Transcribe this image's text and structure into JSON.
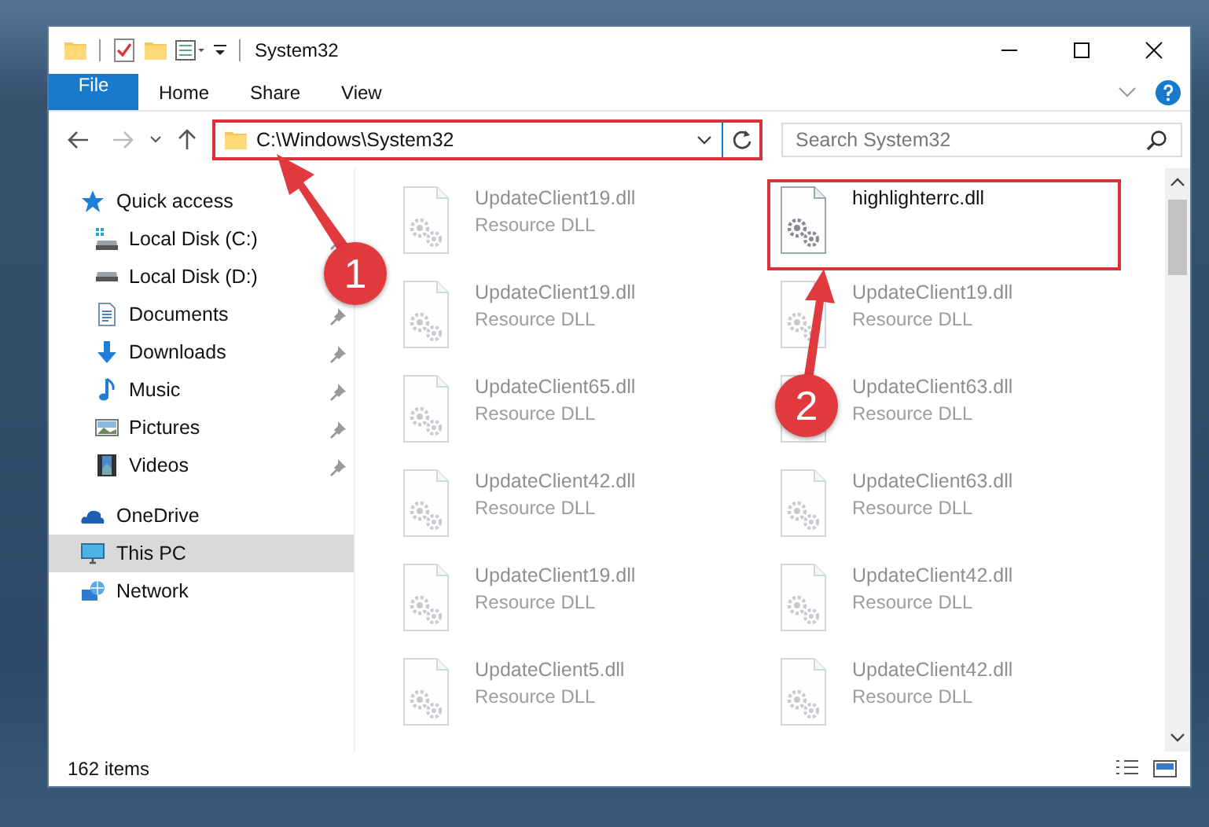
{
  "window": {
    "title": "System32"
  },
  "ribbon": {
    "tabs": [
      {
        "label": "File",
        "kind": "backstage"
      },
      {
        "label": "Home",
        "kind": "tab"
      },
      {
        "label": "Share",
        "kind": "tab"
      },
      {
        "label": "View",
        "kind": "tab"
      }
    ]
  },
  "address_bar": {
    "path": "C:\\Windows\\System32",
    "highlighted": true
  },
  "search": {
    "placeholder": "Search System32"
  },
  "navigation": [
    {
      "label": "Quick access",
      "kind": "star",
      "selected": false,
      "children": [
        {
          "label": "Local Disk (C:)",
          "kind": "systemdisk",
          "pinned": true,
          "selected": false
        },
        {
          "label": "Local Disk (D:)",
          "kind": "disk",
          "selected": false
        },
        {
          "label": "Documents",
          "kind": "documents",
          "pinned": true,
          "selected": false
        },
        {
          "label": "Downloads",
          "kind": "downloads",
          "pinned": true,
          "selected": false
        },
        {
          "label": "Music",
          "kind": "music",
          "pinned": true,
          "selected": false
        },
        {
          "label": "Pictures",
          "kind": "pictures",
          "pinned": true,
          "selected": false
        },
        {
          "label": "Videos",
          "kind": "videos",
          "pinned": true,
          "selected": false
        }
      ]
    },
    {
      "label": "OneDrive",
      "kind": "cloud",
      "selected": false
    },
    {
      "label": "This PC",
      "kind": "pc",
      "selected": true
    },
    {
      "label": "Network",
      "kind": "network",
      "selected": false
    }
  ],
  "files": [
    {
      "name": "UpdateClient19.dll",
      "type": "Resource DLL",
      "blurred": true,
      "highlighted": false
    },
    {
      "name": "highlighterrc.dll",
      "blurred": false,
      "highlighted": true
    },
    {
      "name": "UpdateClient19.dll",
      "type": "Resource DLL",
      "blurred": true,
      "highlighted": false
    },
    {
      "name": "UpdateClient19.dll",
      "type": "Resource DLL",
      "blurred": true,
      "highlighted": false
    },
    {
      "name": "UpdateClient65.dll",
      "type": "Resource DLL",
      "blurred": true,
      "highlighted": false
    },
    {
      "name": "UpdateClient63.dll",
      "type": "Resource DLL",
      "blurred": true,
      "highlighted": false
    },
    {
      "name": "UpdateClient42.dll",
      "type": "Resource DLL",
      "blurred": true,
      "highlighted": false
    },
    {
      "name": "UpdateClient63.dll",
      "type": "Resource DLL",
      "blurred": true,
      "highlighted": false
    },
    {
      "name": "UpdateClient19.dll",
      "type": "Resource DLL",
      "blurred": true,
      "highlighted": false
    },
    {
      "name": "UpdateClient42.dll",
      "type": "Resource DLL",
      "blurred": true,
      "highlighted": false
    },
    {
      "name": "UpdateClient5.dll",
      "type": "Resource DLL",
      "blurred": true,
      "highlighted": false
    },
    {
      "name": "UpdateClient42.dll",
      "type": "Resource DLL",
      "blurred": true,
      "highlighted": false
    }
  ],
  "status_bar": {
    "item_count": "162 items"
  },
  "annotations": [
    {
      "label": "1"
    },
    {
      "label": "2"
    }
  ]
}
